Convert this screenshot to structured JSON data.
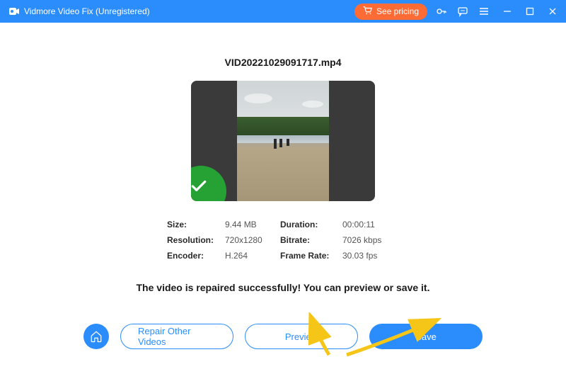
{
  "titlebar": {
    "app_name": "Vidmore Video Fix (Unregistered)",
    "pricing_label": "See pricing"
  },
  "file": {
    "name": "VID20221029091717.mp4"
  },
  "meta": {
    "size_label": "Size:",
    "size_value": "9.44 MB",
    "duration_label": "Duration:",
    "duration_value": "00:00:11",
    "resolution_label": "Resolution:",
    "resolution_value": "720x1280",
    "bitrate_label": "Bitrate:",
    "bitrate_value": "7026 kbps",
    "encoder_label": "Encoder:",
    "encoder_value": "H.264",
    "framerate_label": "Frame Rate:",
    "framerate_value": "30.03 fps"
  },
  "status": {
    "message": "The video is repaired successfully! You can preview or save it."
  },
  "actions": {
    "repair_label": "Repair Other Videos",
    "preview_label": "Preview",
    "save_label": "Save"
  }
}
